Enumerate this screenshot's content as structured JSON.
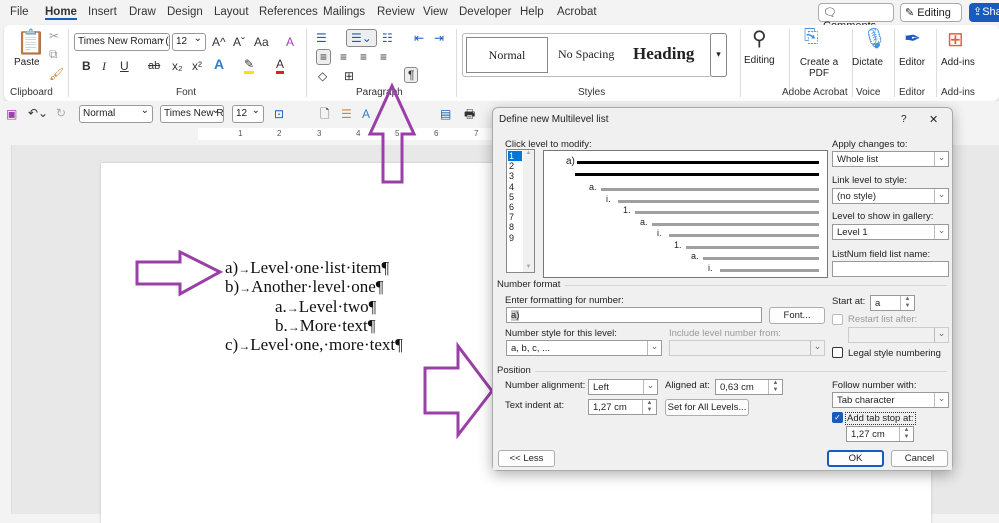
{
  "menu": {
    "tabs": [
      "File",
      "Home",
      "Insert",
      "Draw",
      "Design",
      "Layout",
      "References",
      "Mailings",
      "Review",
      "View",
      "Developer",
      "Help",
      "Acrobat"
    ],
    "active": "Home",
    "comments": "Comments",
    "editing": "Editing",
    "share": "Share"
  },
  "ribbon": {
    "clipboard": {
      "paste": "Paste",
      "label": "Clipboard"
    },
    "font": {
      "name": "Times New Roman (",
      "size": "12",
      "label": "Font",
      "grow": "A^",
      "shrink": "Aˇ",
      "case": "Aa",
      "bold": "B",
      "italic": "I",
      "underline": "U",
      "strike": "ab",
      "sub": "x₂",
      "sup": "x²"
    },
    "paragraph": {
      "label": "Paragraph"
    },
    "styles": {
      "items": [
        "Normal",
        "No Spacing",
        "Heading"
      ],
      "label": "Styles"
    },
    "editing": "Editing",
    "create_pdf": "Create a PDF",
    "acrobat_label": "Adobe Acrobat",
    "dictate": "Dictate",
    "voice_label": "Voice",
    "editor": "Editor",
    "editor_label": "Editor",
    "addins": "Add-ins",
    "addins_label": "Add-ins"
  },
  "qat": {
    "style": "Normal",
    "font": "Times New Rc",
    "size": "12"
  },
  "ruler": [
    "1",
    "2",
    "3",
    "4",
    "5",
    "6",
    "7"
  ],
  "document": {
    "lines": [
      {
        "num": "a)",
        "text": "Level·one·list·item¶",
        "level": 1
      },
      {
        "num": "b)",
        "text": "Another·level·one¶",
        "level": 1
      },
      {
        "num": "a.",
        "text": "Level·two¶",
        "level": 2
      },
      {
        "num": "b.",
        "text": "More·text¶",
        "level": 2
      },
      {
        "num": "c)",
        "text": "Level·one,·more·text¶",
        "level": 1
      }
    ]
  },
  "dialog": {
    "title": "Define new Multilevel list",
    "help": "?",
    "close": "✕",
    "click_level_label": "Click level to modify:",
    "levels": [
      "1",
      "2",
      "3",
      "4",
      "5",
      "6",
      "7",
      "8",
      "9"
    ],
    "selected_level": "1",
    "preview": {
      "first": "a)",
      "labels": [
        "a.",
        "i.",
        "1.",
        "a.",
        "i.",
        "1.",
        "a.",
        "i."
      ]
    },
    "apply_label": "Apply changes to:",
    "apply_value": "Whole list",
    "link_label": "Link level to style:",
    "link_value": "(no style)",
    "gallery_label": "Level to show in gallery:",
    "gallery_value": "Level 1",
    "listnum_label": "ListNum field list name:",
    "listnum_value": "",
    "number_format": "Number format",
    "enter_format_label": "Enter formatting for number:",
    "enter_format_value": "a)",
    "font_button": "Font...",
    "start_label": "Start at:",
    "start_value": "a",
    "restart_label": "Restart list after:",
    "restart_value": "",
    "style_label": "Number style for this level:",
    "style_value": "a, b, c, ...",
    "include_label": "Include level number from:",
    "include_value": "",
    "legal_label": "Legal style numbering",
    "legal_checked": false,
    "position": "Position",
    "alignment_label": "Number alignment:",
    "alignment_value": "Left",
    "aligned_at_label": "Aligned at:",
    "aligned_at_value": "0,63 cm",
    "indent_label": "Text indent at:",
    "indent_value": "1,27 cm",
    "set_all_button": "Set for All Levels...",
    "follow_label": "Follow number with:",
    "follow_value": "Tab character",
    "tabstop_label": "Add tab stop at:",
    "tabstop_checked": true,
    "tabstop_value": "1,27 cm",
    "less_button": "<< Less",
    "ok_button": "OK",
    "cancel_button": "Cancel"
  },
  "colors": {
    "accent": "#185abd",
    "annotation": "#9b3fa8"
  }
}
